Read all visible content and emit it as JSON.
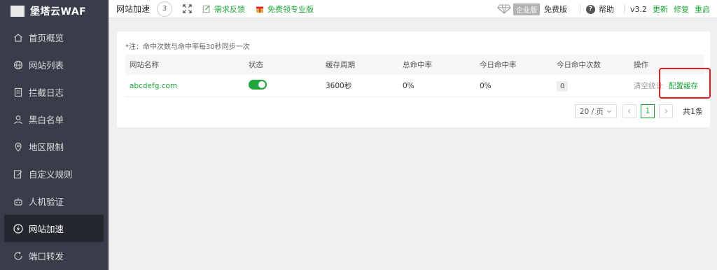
{
  "app": {
    "logo_text": "堡塔云WAF"
  },
  "sidebar": {
    "items": [
      {
        "label": "首页概览",
        "icon": "home-icon"
      },
      {
        "label": "网站列表",
        "icon": "globe-icon"
      },
      {
        "label": "拦截日志",
        "icon": "log-icon"
      },
      {
        "label": "黑白名单",
        "icon": "user-icon"
      },
      {
        "label": "地区限制",
        "icon": "location-icon"
      },
      {
        "label": "自定义规则",
        "icon": "edit-icon"
      },
      {
        "label": "人机验证",
        "icon": "robot-icon"
      },
      {
        "label": "网站加速",
        "icon": "bolt-icon",
        "active": true
      },
      {
        "label": "端口转发",
        "icon": "refresh-icon"
      }
    ]
  },
  "topbar": {
    "title": "网站加速",
    "counter": "3",
    "feedback": "需求反馈",
    "free_pro": "免费领专业版",
    "enterprise": "企业版",
    "free": "免费版",
    "help": "帮助",
    "version": "v3.2",
    "update": "更新",
    "repair": "修复",
    "restart": "重启"
  },
  "main": {
    "note": "*注：命中次数与命中率每30秒同步一次",
    "columns": [
      "网站名称",
      "状态",
      "缓存周期",
      "总命中率",
      "今日命中率",
      "今日命中次数",
      "操作"
    ],
    "rows": [
      {
        "site": "abcdefg.com",
        "status_on": true,
        "cycle": "3600秒",
        "total_hit": "0%",
        "today_hit": "0%",
        "today_count": "0",
        "op_clear": "清空统计",
        "op_config": "配置缓存"
      }
    ],
    "pagination": {
      "page_size": "20 / 页",
      "current": "1",
      "total": "共1条"
    }
  },
  "colors": {
    "accent": "#20a53a",
    "sidebar_bg": "#393d49",
    "highlight": "#e02020"
  }
}
